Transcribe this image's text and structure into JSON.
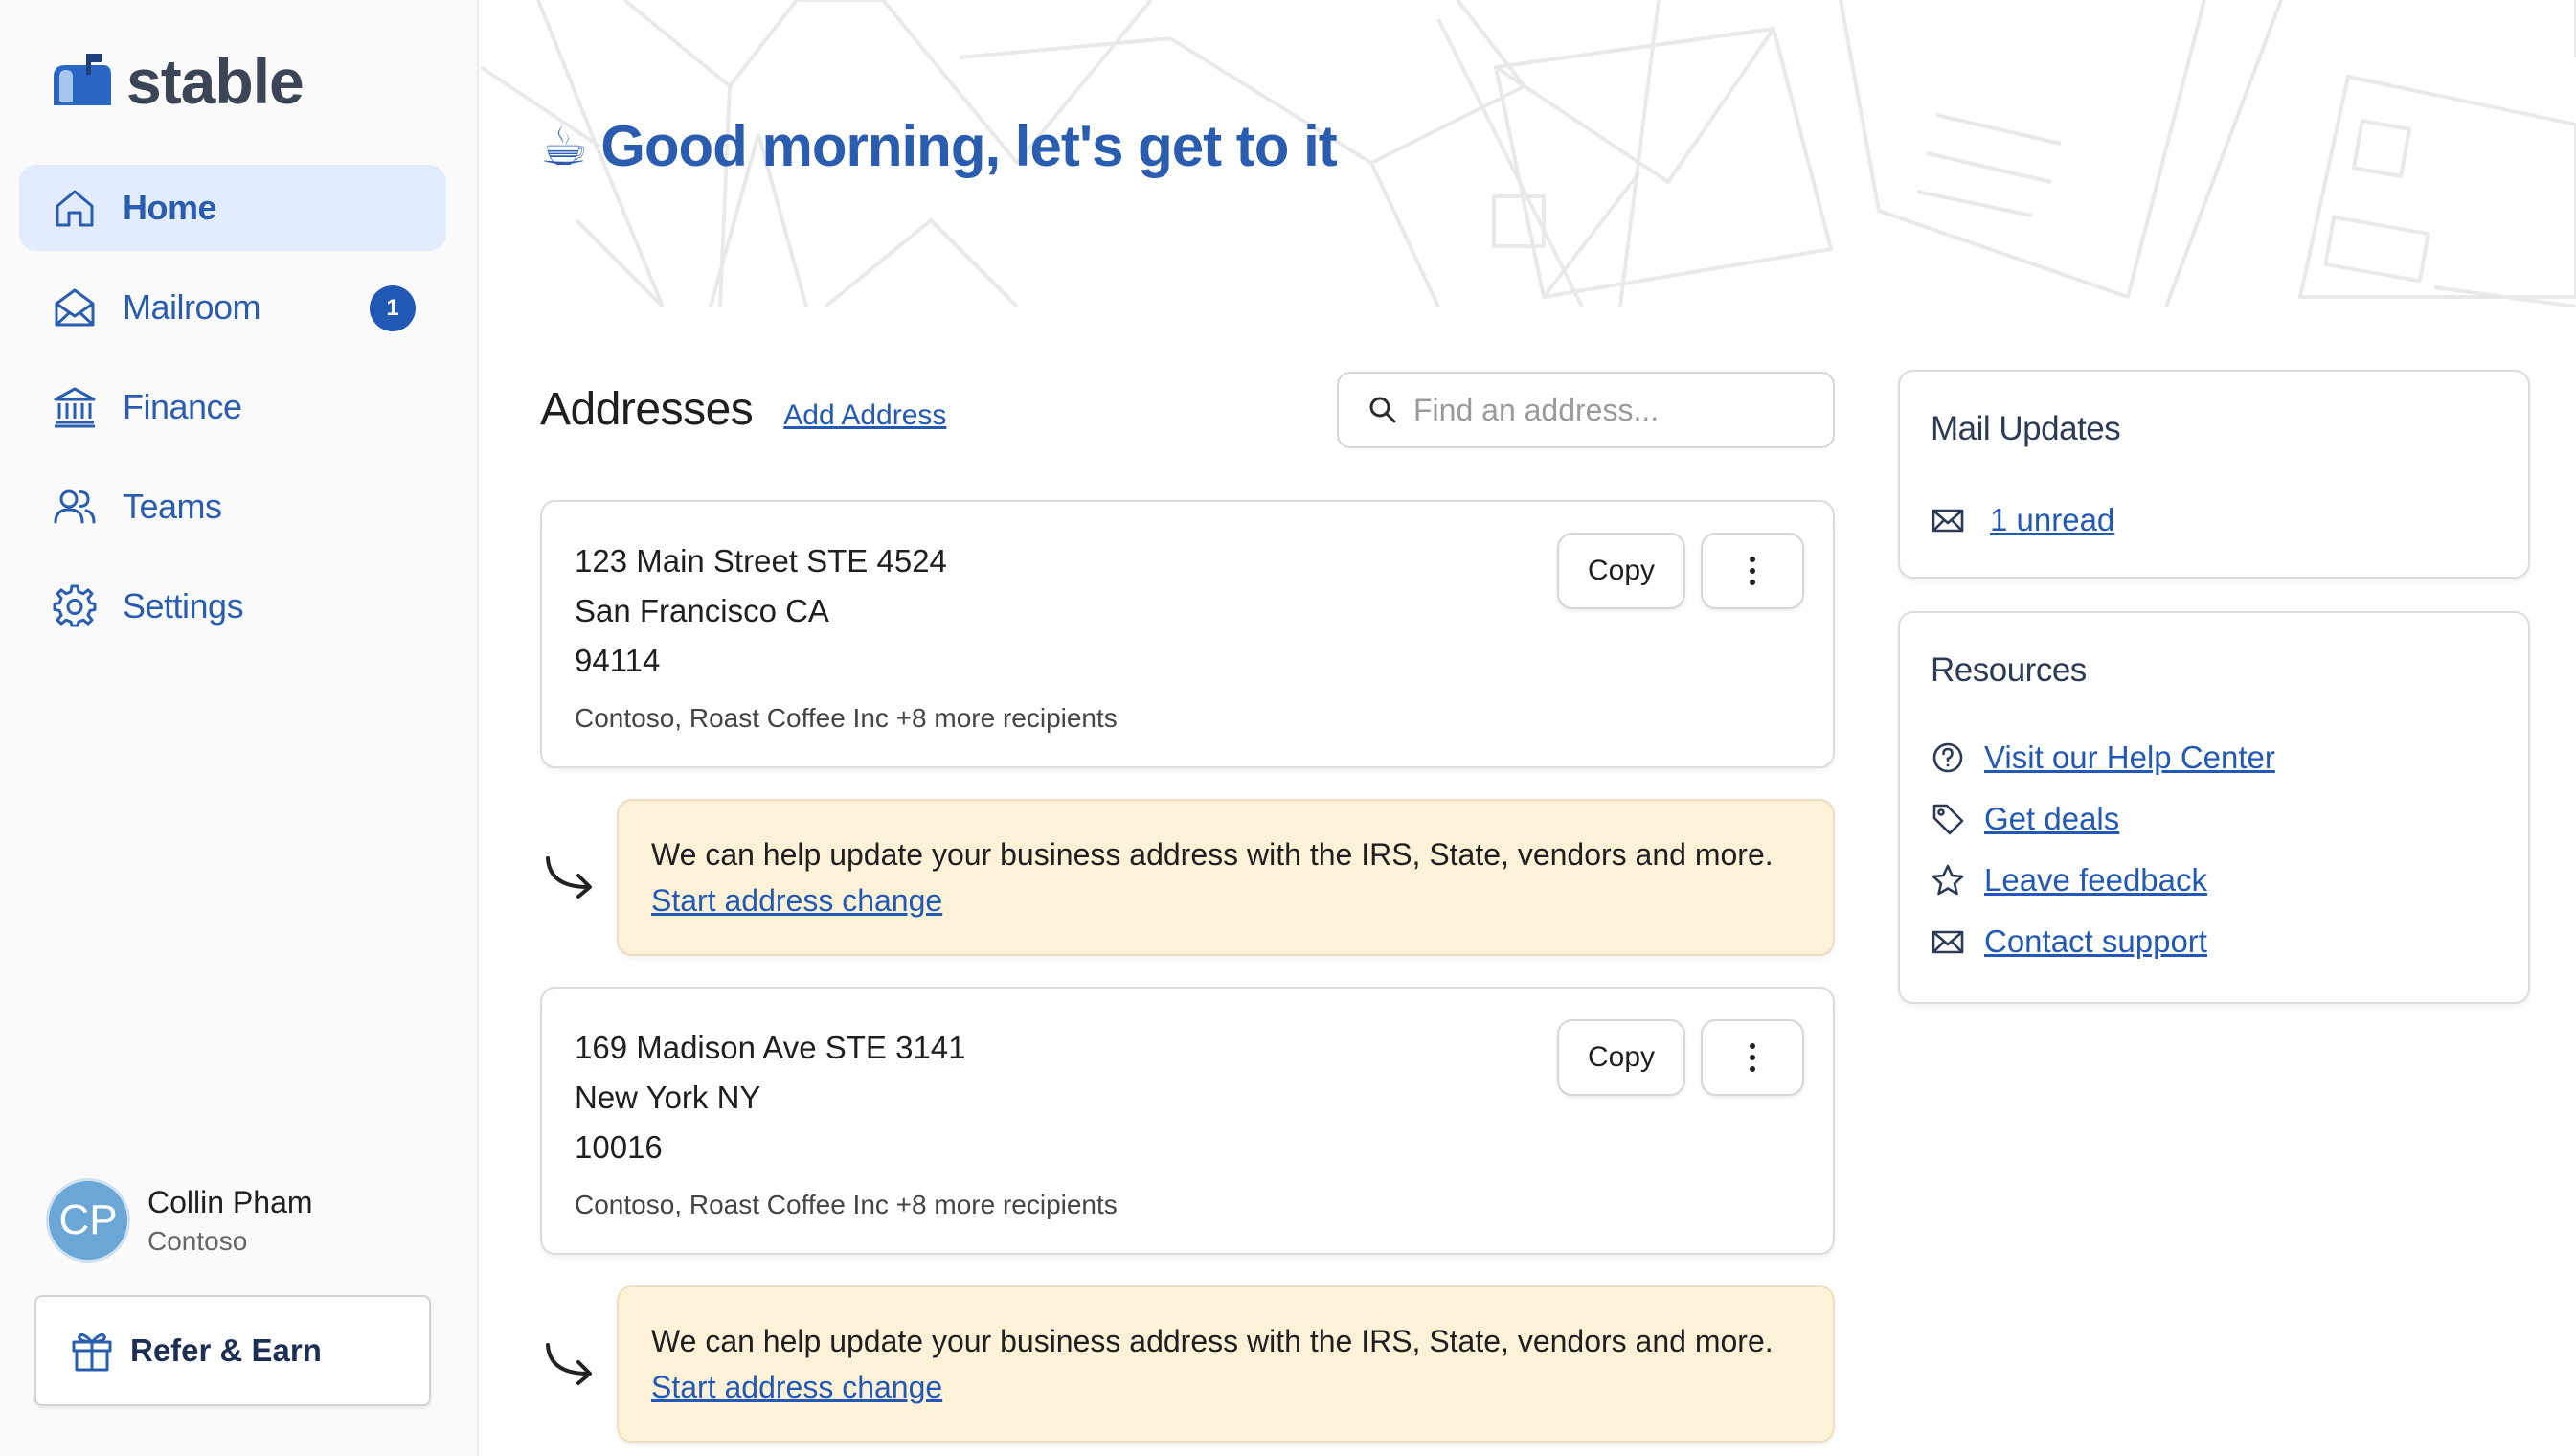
{
  "brand": {
    "name": "stable"
  },
  "nav": {
    "items": [
      {
        "label": "Home",
        "icon": "home-icon"
      },
      {
        "label": "Mailroom",
        "icon": "envelope-open-icon",
        "badge": "1"
      },
      {
        "label": "Finance",
        "icon": "bank-icon"
      },
      {
        "label": "Teams",
        "icon": "users-icon"
      },
      {
        "label": "Settings",
        "icon": "gear-icon"
      }
    ]
  },
  "user": {
    "initials": "CP",
    "name": "Collin Pham",
    "org": "Contoso"
  },
  "refer": {
    "label": "Refer & Earn"
  },
  "hero": {
    "emoji": "☕",
    "greeting": "Good morning, let's get to it"
  },
  "addresses": {
    "title": "Addresses",
    "add_label": "Add Address",
    "search_placeholder": "Find an address...",
    "copy_label": "Copy",
    "items": [
      {
        "line1": "123 Main Street STE 4524",
        "line2": "San Francisco  CA",
        "line3": "94114",
        "recipients": "Contoso, Roast Coffee Inc +8 more recipients"
      },
      {
        "line1": "169 Madison Ave STE 3141",
        "line2": "New York  NY",
        "line3": "10016",
        "recipients": "Contoso, Roast Coffee Inc +8 more recipients"
      }
    ],
    "notice": {
      "text": "We can help update your business address with the IRS, State, vendors and more.",
      "link": "Start address change"
    }
  },
  "mail_updates": {
    "title": "Mail Updates",
    "unread": "1 unread"
  },
  "resources": {
    "title": "Resources",
    "links": [
      {
        "label": "Visit our Help Center",
        "icon": "help-circle-icon"
      },
      {
        "label": "Get deals",
        "icon": "tag-icon"
      },
      {
        "label": "Leave feedback",
        "icon": "star-icon"
      },
      {
        "label": "Contact support",
        "icon": "mail-icon"
      }
    ]
  },
  "colors": {
    "accent": "#2a5db0",
    "badge": "#2259b4",
    "active_nav": "#e3ecfc",
    "notice_bg": "#fdf2d7"
  }
}
